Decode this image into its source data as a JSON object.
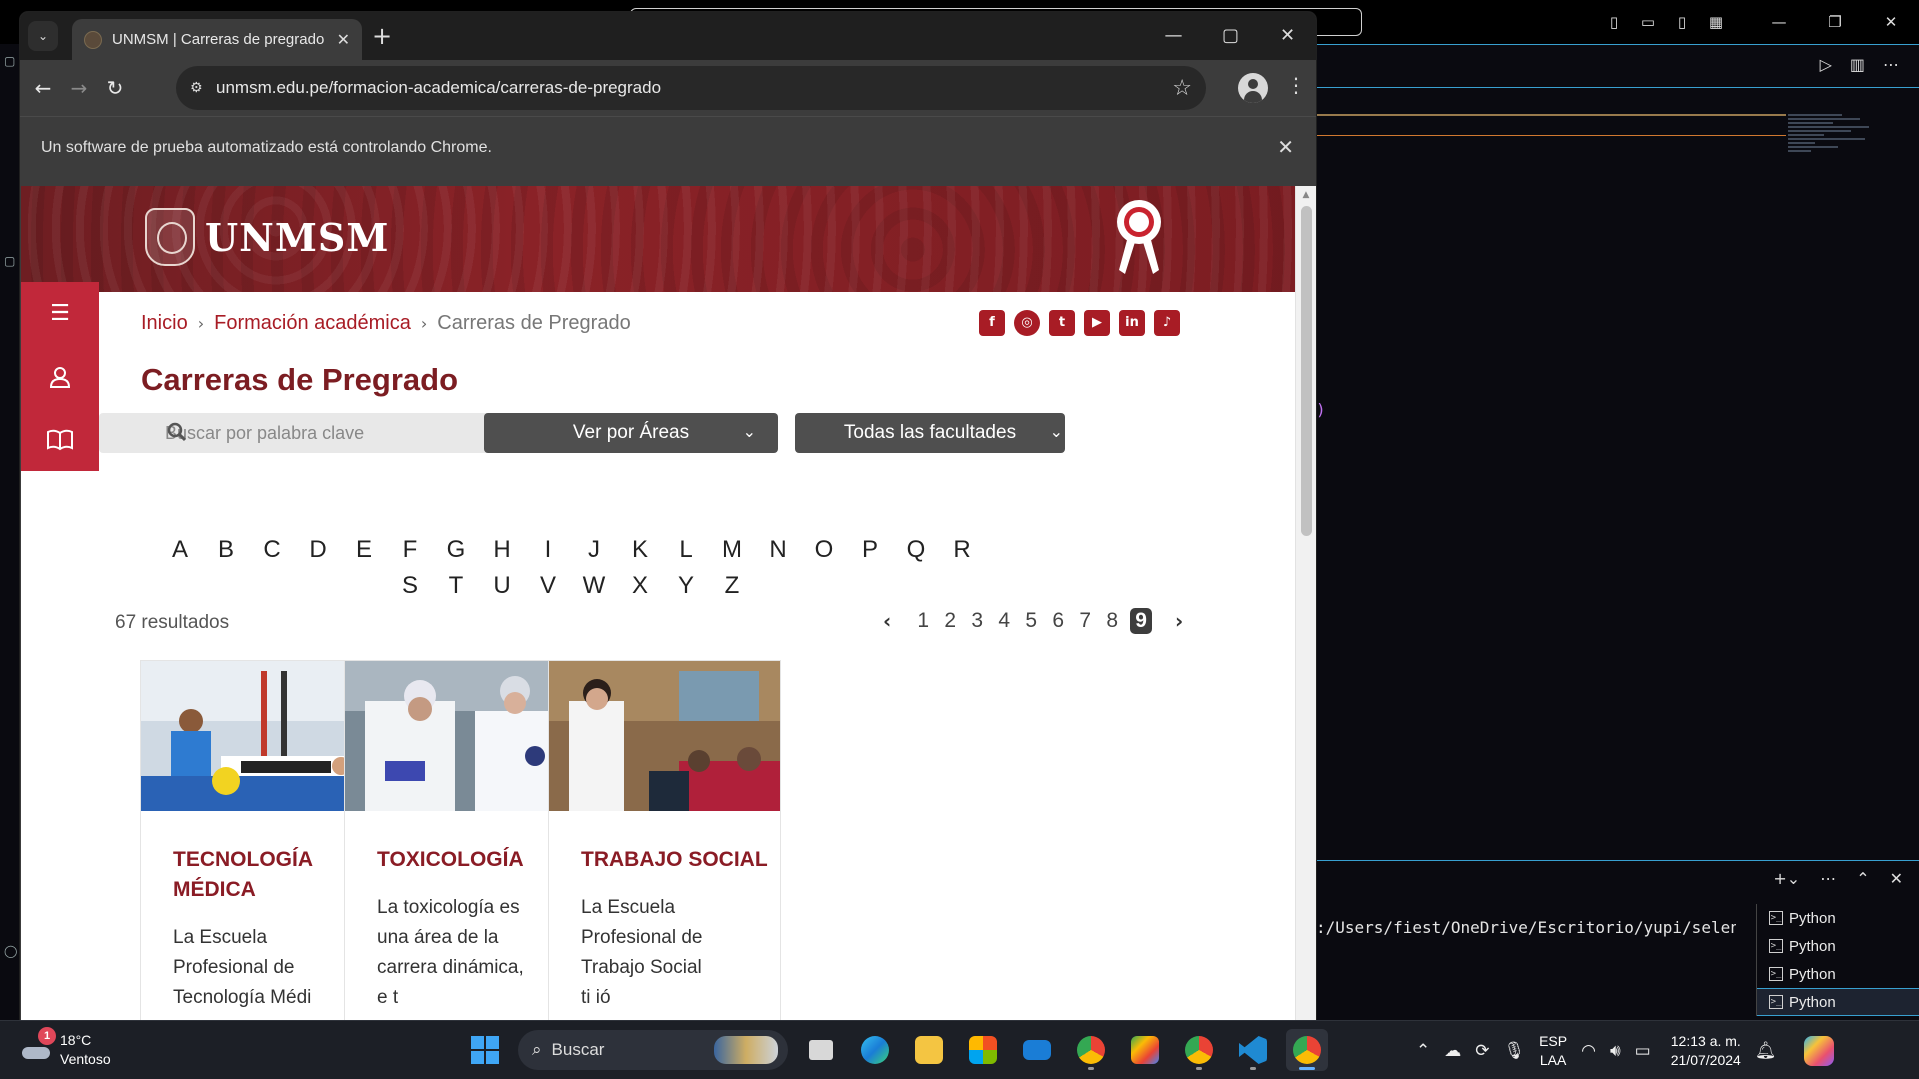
{
  "vscode": {
    "terminal_path": ":/Users/fiest/OneDrive/Escritorio/yupi/seleniu",
    "paren": ")",
    "terminals": [
      "Python",
      "Python",
      "Python",
      "Python"
    ],
    "colors": {
      "accent_border": "#38a0d0"
    }
  },
  "browser": {
    "tab_title": "UNMSM | Carreras de pregrado",
    "url": "unmsm.edu.pe/formacion-academica/carreras-de-pregrado",
    "infobar_text": "Un software de prueba automatizado está controlando Chrome."
  },
  "page": {
    "logo_text": "UNMSM",
    "breadcrumb": {
      "home": "Inicio",
      "section": "Formación académica",
      "current": "Carreras de Pregrado"
    },
    "social": [
      {
        "icon": "facebook-icon",
        "glyph": "f"
      },
      {
        "icon": "instagram-icon",
        "glyph": "◎"
      },
      {
        "icon": "twitter-icon",
        "glyph": "t"
      },
      {
        "icon": "youtube-icon",
        "glyph": "▶"
      },
      {
        "icon": "linkedin-icon",
        "glyph": "in"
      },
      {
        "icon": "tiktok-icon",
        "glyph": "♪"
      }
    ],
    "title": "Carreras de Pregrado",
    "search_placeholder": "Buscar por palabra clave",
    "filter_areas": "Ver por Áreas",
    "filter_faculties": "Todas las facultades",
    "alphabet": [
      "A",
      "B",
      "C",
      "D",
      "E",
      "F",
      "G",
      "H",
      "I",
      "J",
      "K",
      "L",
      "M",
      "N",
      "O",
      "P",
      "Q",
      "R",
      "S",
      "T",
      "U",
      "V",
      "W",
      "X",
      "Y",
      "Z"
    ],
    "results": "67 resultados",
    "pages": [
      "1",
      "2",
      "3",
      "4",
      "5",
      "6",
      "7",
      "8",
      "9"
    ],
    "current_page": "9",
    "cards": [
      {
        "title": "TECNOLOGÍA MÉDICA",
        "desc": [
          "La Escuela",
          "Profesional de",
          "Tecnología Médi"
        ]
      },
      {
        "title": "TOXICOLOGÍA",
        "desc": [
          "La toxicología es",
          "una área de la",
          "carrera dinámica,",
          "e     t  "
        ]
      },
      {
        "title": "TRABAJO SOCIAL",
        "desc": [
          "La Escuela",
          "Profesional de",
          "Trabajo Social",
          "ti          ió"
        ]
      }
    ],
    "colors": {
      "brand": "#8a1c25",
      "side_button": "#c1283a",
      "filter_button": "#4f4f4f"
    }
  },
  "taskbar": {
    "weather_temp": "18°C",
    "weather_desc": "Ventoso",
    "weather_badge": "1",
    "search_label": "Buscar",
    "lang_top": "ESP",
    "lang_bottom": "LAA",
    "time": "12:13 a. m.",
    "date": "21/07/2024"
  }
}
